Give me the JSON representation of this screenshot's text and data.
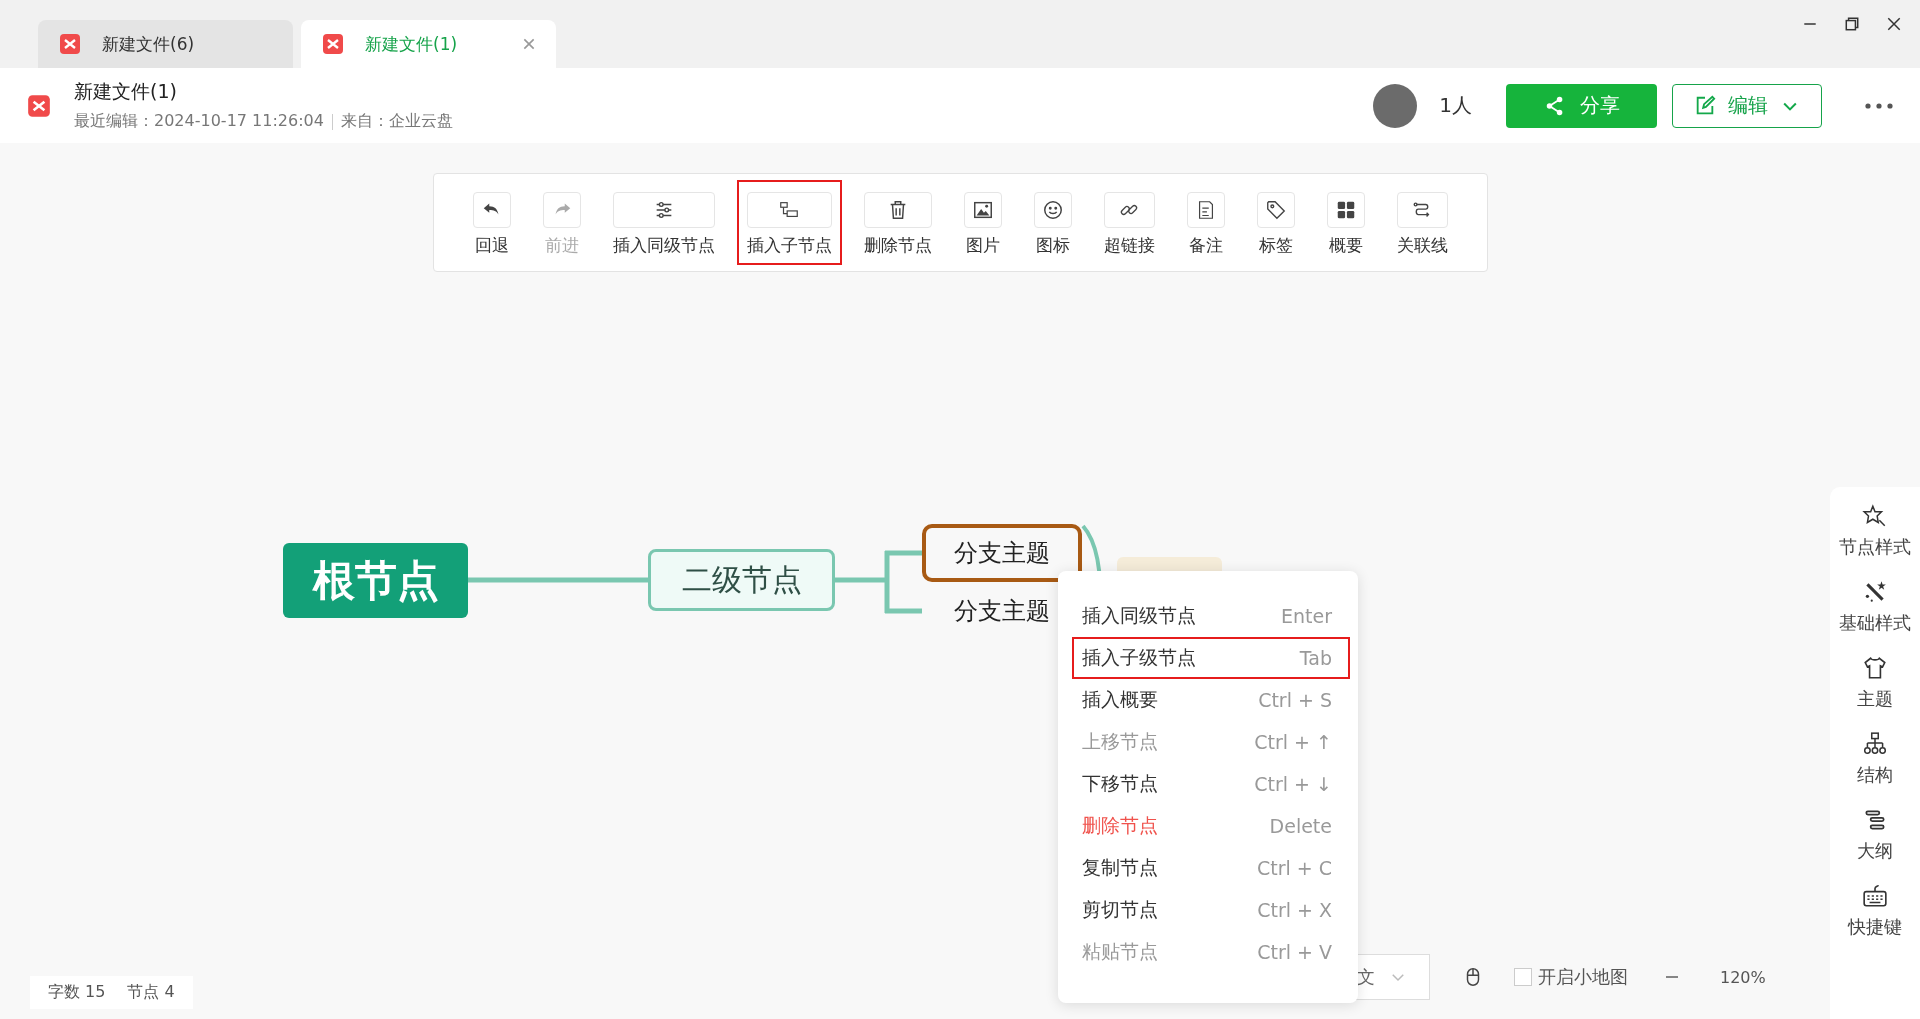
{
  "tabs": [
    {
      "title": "新建文件(6)",
      "selected": false
    },
    {
      "title": "新建文件(1)",
      "selected": true
    }
  ],
  "document": {
    "title": "新建文件(1)",
    "last_edited": "最近编辑：2024-10-17 11:26:04",
    "source": "来自：企业云盘"
  },
  "collaborators": "1人",
  "share_button": "分享",
  "edit_button": "编辑",
  "toolbar": [
    {
      "label": "回退",
      "disabled": false,
      "highlighted": false
    },
    {
      "label": "前进",
      "disabled": true,
      "highlighted": false
    },
    {
      "label": "插入同级节点",
      "disabled": false,
      "highlighted": false
    },
    {
      "label": "插入子节点",
      "disabled": false,
      "highlighted": true
    },
    {
      "label": "删除节点",
      "disabled": false,
      "highlighted": false
    },
    {
      "label": "图片",
      "disabled": false,
      "highlighted": false
    },
    {
      "label": "图标",
      "disabled": false,
      "highlighted": false
    },
    {
      "label": "超链接",
      "disabled": false,
      "highlighted": false
    },
    {
      "label": "备注",
      "disabled": false,
      "highlighted": false
    },
    {
      "label": "标签",
      "disabled": false,
      "highlighted": false
    },
    {
      "label": "概要",
      "disabled": false,
      "highlighted": false
    },
    {
      "label": "关联线",
      "disabled": false,
      "highlighted": false
    }
  ],
  "mind_map": {
    "text": "根节点",
    "children": [
      {
        "text": "二级节点",
        "children": [
          {
            "text": "分支主题",
            "selected": true
          },
          {
            "text": "分支主题",
            "selected": false
          }
        ]
      }
    ]
  },
  "context_menu": [
    {
      "label": "插入同级节点",
      "shortcut": "Enter",
      "disabled": false,
      "danger": false,
      "highlighted": false
    },
    {
      "label": "插入子级节点",
      "shortcut": "Tab",
      "disabled": false,
      "danger": false,
      "highlighted": true
    },
    {
      "label": "插入概要",
      "shortcut": "Ctrl + S",
      "disabled": false,
      "danger": false,
      "highlighted": false
    },
    {
      "label": "上移节点",
      "shortcut": "Ctrl + ↑",
      "disabled": true,
      "danger": false,
      "highlighted": false
    },
    {
      "label": "下移节点",
      "shortcut": "Ctrl + ↓",
      "disabled": false,
      "danger": false,
      "highlighted": false
    },
    {
      "label": "删除节点",
      "shortcut": "Delete",
      "disabled": false,
      "danger": true,
      "highlighted": false
    },
    {
      "label": "复制节点",
      "shortcut": "Ctrl + C",
      "disabled": false,
      "danger": false,
      "highlighted": false
    },
    {
      "label": "剪切节点",
      "shortcut": "Ctrl + X",
      "disabled": false,
      "danger": false,
      "highlighted": false
    },
    {
      "label": "粘贴节点",
      "shortcut": "Ctrl + V",
      "disabled": true,
      "danger": false,
      "highlighted": false
    }
  ],
  "status": {
    "word_count_label": "字数",
    "word_count": "15",
    "node_count_label": "节点",
    "node_count": "4"
  },
  "language": "文",
  "minimap": {
    "label": "开启小地图",
    "checked": false
  },
  "zoom": "120%",
  "sidebar": [
    {
      "label": "节点样式"
    },
    {
      "label": "基础样式"
    },
    {
      "label": "主题"
    },
    {
      "label": "结构"
    },
    {
      "label": "大纲"
    },
    {
      "label": "快捷键"
    }
  ]
}
